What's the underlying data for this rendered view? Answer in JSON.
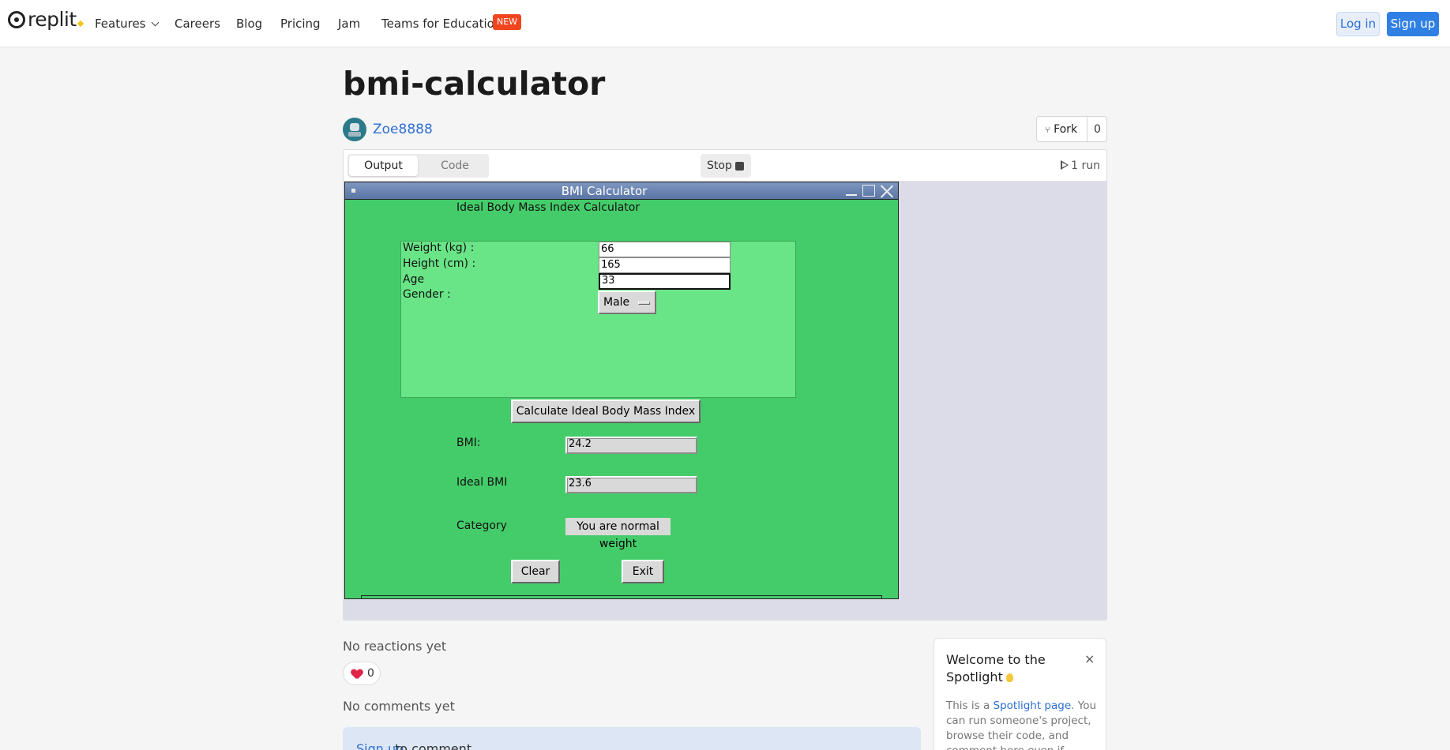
{
  "nav": {
    "logo_text": "replit",
    "items": [
      {
        "label": "Features"
      },
      {
        "label": "Careers"
      },
      {
        "label": "Blog"
      },
      {
        "label": "Pricing"
      },
      {
        "label": "Jam"
      },
      {
        "label": "Teams for Education"
      }
    ],
    "new_badge": "NEW",
    "login": "Log in",
    "signup": "Sign up"
  },
  "repl": {
    "title": "bmi-calculator",
    "author": "Zoe8888",
    "fork_label": "Fork",
    "fork_count": "0"
  },
  "panel": {
    "tab_output": "Output",
    "tab_code": "Code",
    "stop": "Stop",
    "runs": "1 run"
  },
  "app": {
    "window_title": "BMI Calculator",
    "heading": "Ideal Body Mass Index Calculator",
    "weight_label": "Weight (kg) :",
    "weight_value": "66",
    "height_label": "Height (cm) :",
    "height_value": "165",
    "age_label": "Age",
    "age_value": "33",
    "gender_label": "Gender :",
    "gender_value": "Male",
    "calc_button": "Calculate Ideal Body Mass Index",
    "bmi_label": "BMI:",
    "bmi_value": "24.2",
    "ideal_label": "Ideal BMI",
    "ideal_value": "23.6",
    "category_label": "Category",
    "category_value": "You are normal weight",
    "clear_button": "Clear",
    "exit_button": "Exit"
  },
  "social": {
    "no_reactions": "No reactions yet",
    "heart_count": "0",
    "no_comments": "No comments yet",
    "signup_link": "Sign up",
    "signup_rest": "to comment"
  },
  "spotlight": {
    "title": "Welcome to the Spotlight",
    "close": "×",
    "body_prefix": "This is a ",
    "body_link": "Spotlight page",
    "body_suffix": ". You can run someone's project, browse their code, and comment here even if"
  },
  "colors": {
    "tk_background": "#45cc6a",
    "tk_frame": "#69e587",
    "brand_blue": "#2f7fe4",
    "badge_red": "#f1451f"
  }
}
